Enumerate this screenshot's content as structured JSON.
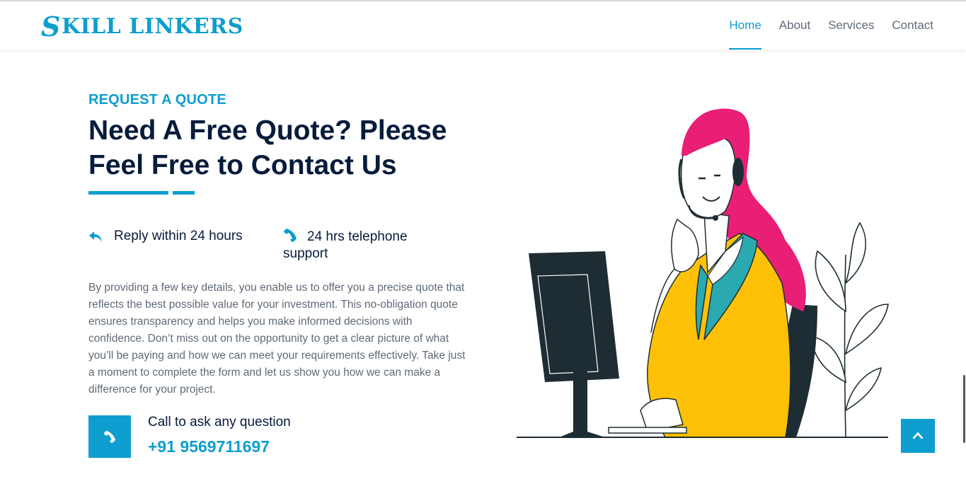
{
  "brand": {
    "logo_s": "S",
    "logo_rest": "KILL LINKERS",
    "accent": "#0d9ecf",
    "dark": "#071b3b"
  },
  "nav": [
    {
      "label": "Home",
      "active": true
    },
    {
      "label": "About",
      "active": false
    },
    {
      "label": "Services",
      "active": false
    },
    {
      "label": "Contact",
      "active": false
    }
  ],
  "quote": {
    "eyebrow": "REQUEST A QUOTE",
    "title": "Need A Free Quote? Please Feel Free to Contact Us",
    "feature1": {
      "icon": "reply-icon",
      "label": "Reply within 24 hours"
    },
    "feature2": {
      "icon": "phone-icon",
      "label": "24 hrs telephone support"
    },
    "paragraph": "By providing a few key details, you enable us to offer you a precise quote that reflects the best possible value for your investment. This no-obligation quote ensures transparency and helps you make informed decisions with confidence. Don’t miss out on the opportunity to get a clear picture of what you’ll be paying and how we can meet your requirements effectively. Take just a moment to complete the form and let us show you how we can make a difference for your project.",
    "call_label": "Call to ask any question",
    "phone": "+91 9569711697"
  },
  "illustration": {
    "icon": "customer-support-illustration"
  },
  "back_to_top": {
    "icon": "chevron-up-icon"
  }
}
